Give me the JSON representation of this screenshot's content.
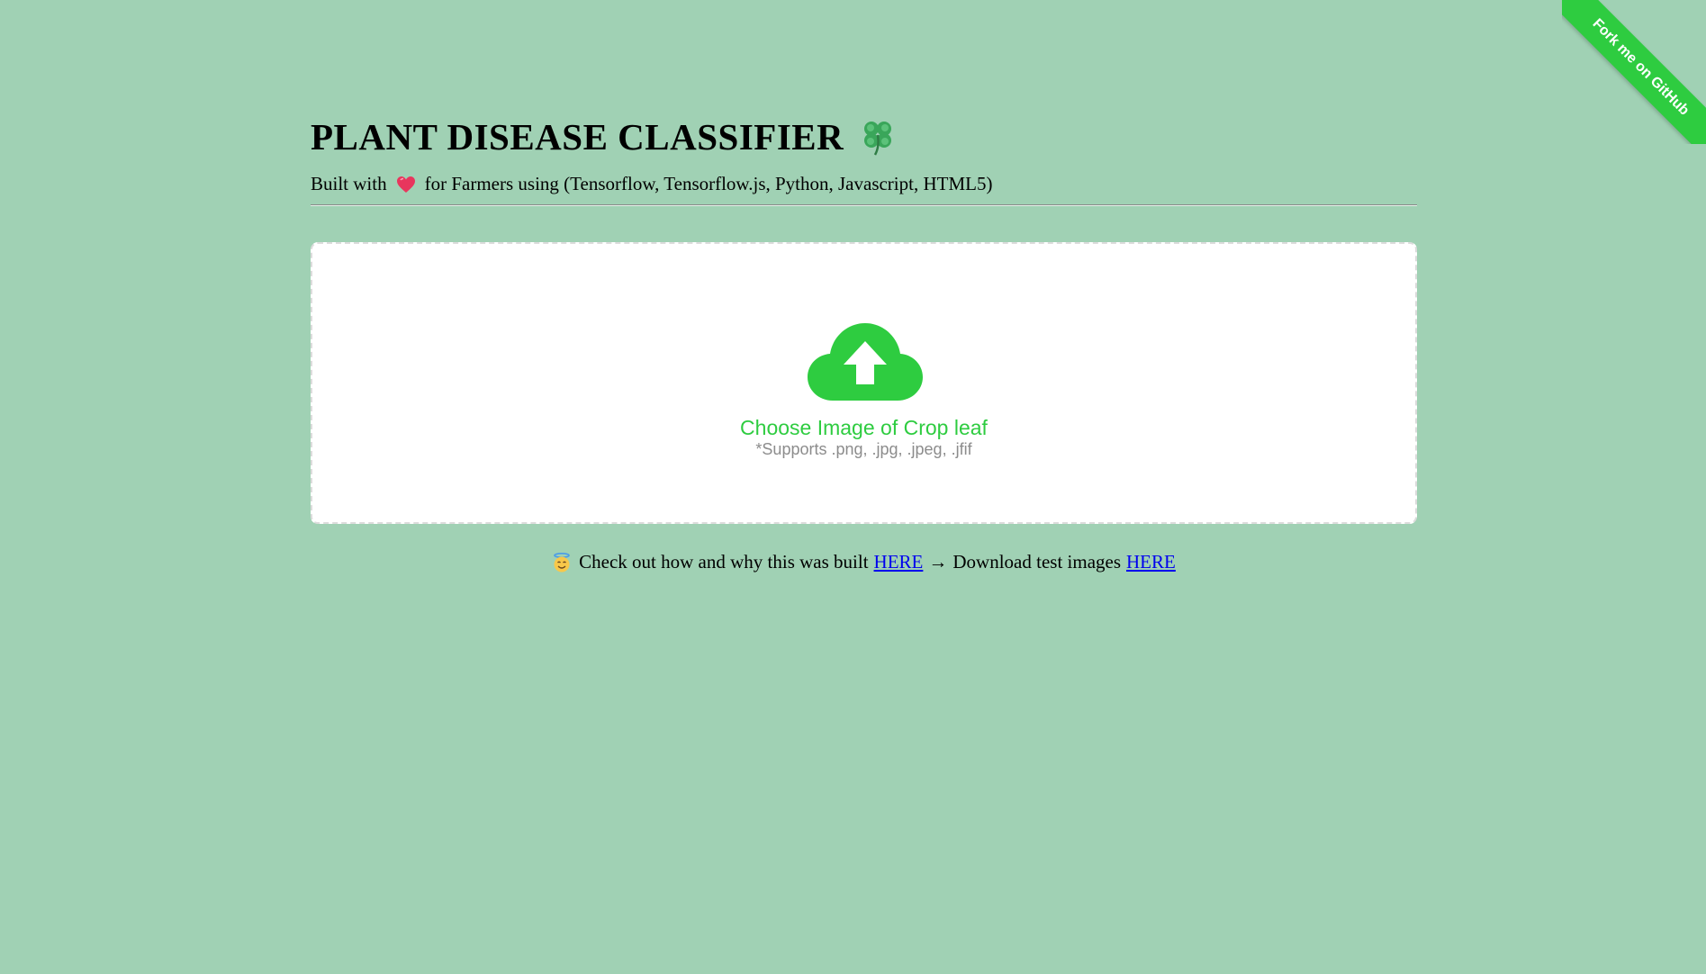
{
  "header": {
    "title": "PLANT DISEASE CLASSIFIER",
    "title_icon": "four-leaf-clover-icon",
    "subtitle_prefix": "Built with",
    "subtitle_icon": "heart-icon",
    "subtitle_suffix": "for Farmers using (Tensorflow, Tensorflow.js, Python, Javascript, HTML5)"
  },
  "upload": {
    "icon": "cloud-upload-icon",
    "label": "Choose Image of Crop leaf",
    "supports": "*Supports .png, .jpg, .jpeg, .jfif"
  },
  "footer": {
    "icon": "smiling-face-with-halo-icon",
    "text_before": "Check out how and why this was built",
    "link1_label": "HERE",
    "arrow": "→",
    "text_middle": "Download test images",
    "link2_label": "HERE"
  },
  "ribbon": {
    "label": "Fork me on GitHub"
  },
  "colors": {
    "background": "#a0d1b4",
    "accent": "#2ecc40",
    "muted_text": "#8c8c8c",
    "link": "#0000ee"
  }
}
